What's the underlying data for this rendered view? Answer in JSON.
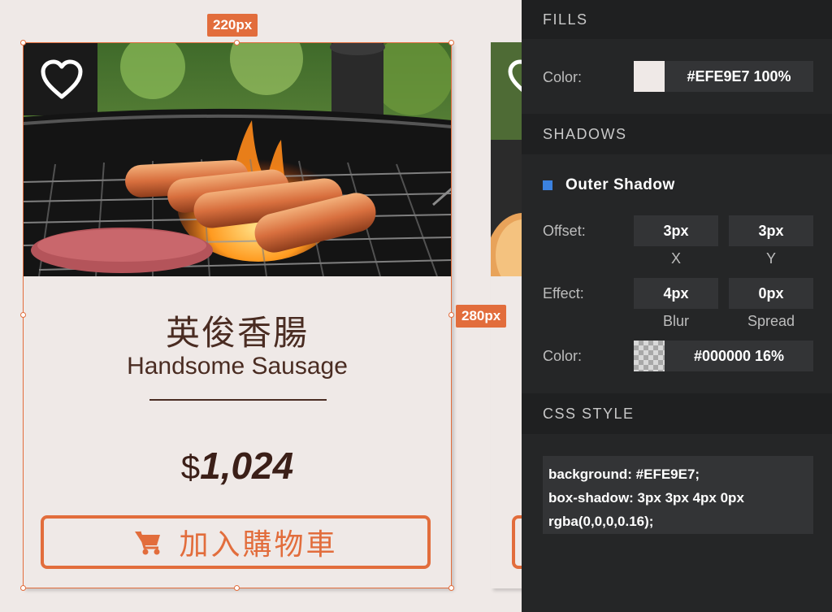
{
  "canvas": {
    "width_badge": "220px",
    "height_badge": "280px",
    "product": {
      "title_cn": "英俊香腸",
      "title_en": "Handsome Sausage",
      "currency": "$",
      "price": "1,024",
      "cart_label": "加入購物車",
      "icons": {
        "favorite": "heart-outline-icon",
        "cart": "shopping-cart-icon"
      },
      "colors": {
        "accent": "#E26D3C",
        "text": "#4A2C22",
        "background": "#EFE9E7"
      }
    }
  },
  "inspector": {
    "fills": {
      "header": "FILLS",
      "color_label": "Color:",
      "color_value": "#EFE9E7 100%",
      "swatch_color": "#EFE9E7"
    },
    "shadows": {
      "header": "SHADOWS",
      "type": "Outer Shadow",
      "type_color": "#3B82E0",
      "offset_label": "Offset:",
      "offset_x": "3px",
      "offset_y": "3px",
      "x_label": "X",
      "y_label": "Y",
      "effect_label": "Effect:",
      "blur": "4px",
      "spread": "0px",
      "blur_label": "Blur",
      "spread_label": "Spread",
      "color_label": "Color:",
      "color_value": "#000000 16%"
    },
    "css_style": {
      "header": "CSS STYLE",
      "lines": [
        "background: #EFE9E7;",
        "box-shadow: 3px 3px 4px 0px",
        "rgba(0,0,0,0.16);"
      ]
    }
  }
}
